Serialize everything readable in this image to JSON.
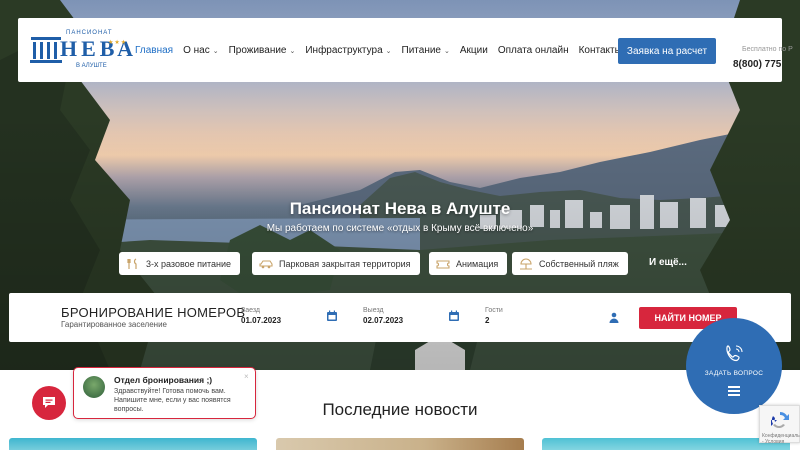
{
  "header": {
    "logo": {
      "pre": "ПАНСИОНАТ",
      "name": "НЕВА",
      "stars": "★★★",
      "place": "В АЛУШТЕ"
    },
    "nav": [
      {
        "label": "Главная",
        "active": true,
        "dropdown": false
      },
      {
        "label": "О нас",
        "active": false,
        "dropdown": true
      },
      {
        "label": "Проживание",
        "active": false,
        "dropdown": true
      },
      {
        "label": "Инфраструктура",
        "active": false,
        "dropdown": true
      },
      {
        "label": "Питание",
        "active": false,
        "dropdown": true
      },
      {
        "label": "Акции",
        "active": false,
        "dropdown": false
      },
      {
        "label": "Оплата онлайн",
        "active": false,
        "dropdown": false
      },
      {
        "label": "Контакты",
        "active": false,
        "dropdown": true
      }
    ],
    "cta_label": "Заявка на расчет",
    "phone_caption": "Бесплатно по Р",
    "phone": "8(800) 775"
  },
  "hero": {
    "title": "Пансионат Нева в Алуште",
    "subtitle": "Мы работаем по системе «отдых в Крыму всё включено»",
    "features": [
      {
        "label": "3-х разовое питание",
        "icon": "cutlery-icon"
      },
      {
        "label": "Парковая закрытая территория",
        "icon": "car-icon"
      },
      {
        "label": "Анимация",
        "icon": "ticket-icon"
      },
      {
        "label": "Собственный пляж",
        "icon": "beach-icon"
      }
    ],
    "more_label": "И ещё..."
  },
  "booking": {
    "title": "БРОНИРОВАНИЕ НОМЕРОВ",
    "subtitle": "Гарантированное заселение",
    "checkin_label": "Заезд",
    "checkin_value": "01.07.2023",
    "checkout_label": "Выезд",
    "checkout_value": "02.07.2023",
    "guests_label": "Гости",
    "guests_value": "2",
    "find_label": "НАЙТИ НОМЕР"
  },
  "ask": {
    "label": "ЗАДАТЬ ВОПРОС"
  },
  "chat": {
    "title": "Отдел бронирования ;)",
    "message": "Здравствуйте! Готова помочь вам. Напишите мне, если у вас появятся вопросы.",
    "close": "×"
  },
  "news": {
    "title": "Последние новости"
  },
  "recaptcha": {
    "terms": "Конфиденциальность - Условия"
  },
  "colors": {
    "brand": "#2f6db4",
    "accent": "#d7263d",
    "active_nav": "#1f6fc6"
  }
}
